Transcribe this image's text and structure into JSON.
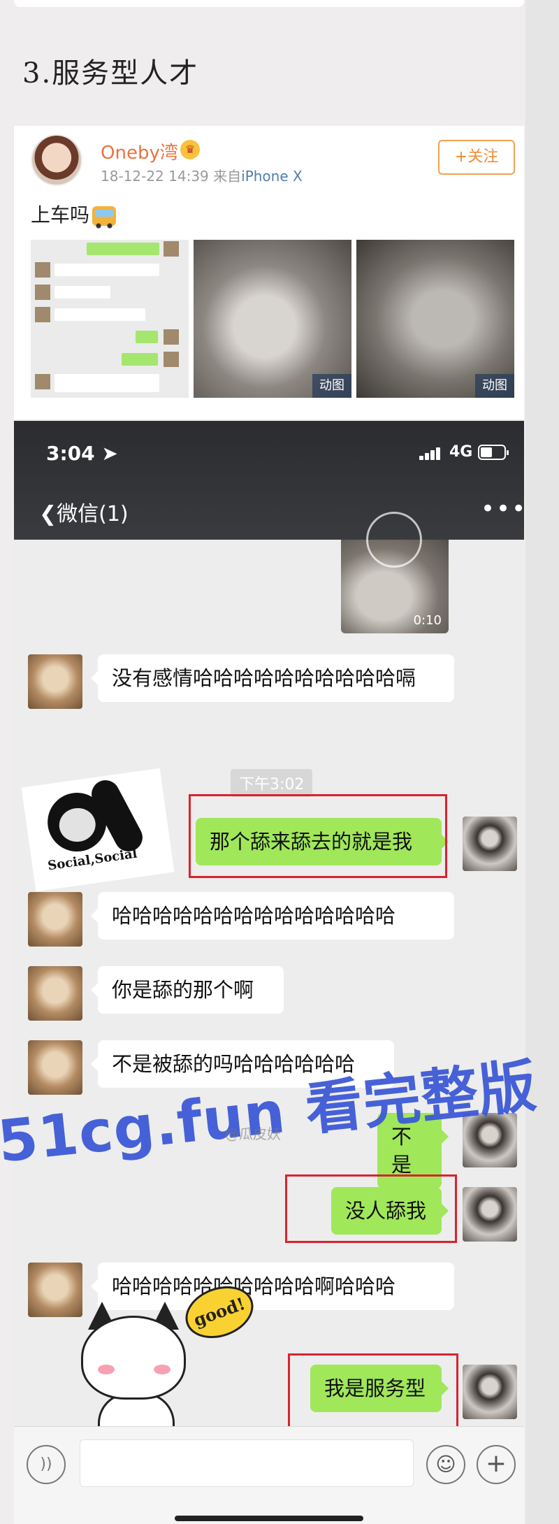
{
  "section": {
    "title": "3.服务型人才"
  },
  "weibo": {
    "user_name": "Oneby湾",
    "badge_icon": "crown-badge-icon",
    "timestamp": "18-12-22 14:39",
    "source_prefix": "来自",
    "source": "iPhone X",
    "follow_label": "+关注",
    "text": "上车吗",
    "text_icon": "bus-emoji-icon",
    "gif_tag": "动图"
  },
  "status_bar": {
    "time": "3:04",
    "network": "4G"
  },
  "nav": {
    "back_label": "微信(1)",
    "more_label": "•••"
  },
  "video": {
    "duration": "0:10"
  },
  "time_separator": "下午3:02",
  "messages": [
    {
      "side": "left",
      "text": "没有感情哈哈哈哈哈哈哈哈哈哈嗝"
    },
    {
      "side": "right",
      "text": "那个舔来舔去的就是我"
    },
    {
      "side": "left",
      "text": "哈哈哈哈哈哈哈哈哈哈哈哈哈哈"
    },
    {
      "side": "left",
      "text": "你是舔的那个啊"
    },
    {
      "side": "left",
      "text": "不是被舔的吗哈哈哈哈哈哈"
    },
    {
      "side": "right",
      "text": "不是"
    },
    {
      "side": "right",
      "text": "没人舔我"
    },
    {
      "side": "left",
      "text": "哈哈哈哈哈哈哈哈哈哈啊哈哈哈"
    },
    {
      "side": "right",
      "text": "我是服务型"
    }
  ],
  "stickers": {
    "panda_text": "Social,Social",
    "cat_text": "good!"
  },
  "watermark": {
    "text": "51cg.fun 看完整版",
    "credit": "@瓜皮妖"
  },
  "input_bar": {
    "voice_icon": "voice-icon",
    "emoji_icon": "emoji-icon",
    "plus_icon": "plus-icon"
  }
}
